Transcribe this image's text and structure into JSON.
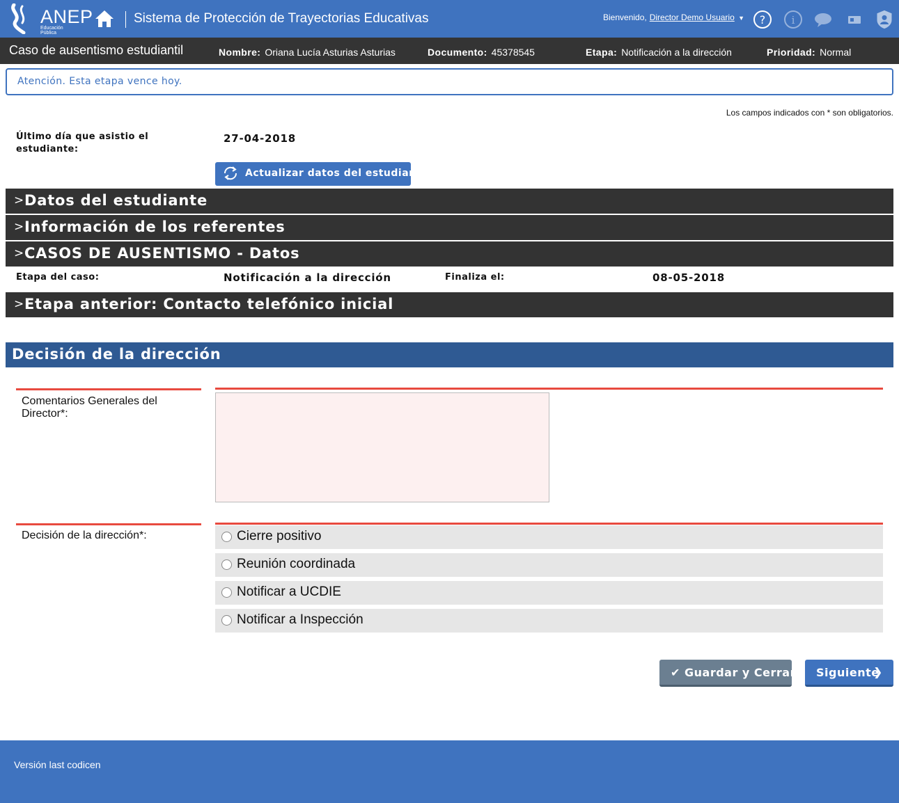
{
  "header": {
    "logo_text": "ANEP",
    "logo_sub": "Educación Pública",
    "app_title": "Sistema de Protección de Trayectorias Educativas",
    "welcome_label": "Bienvenido,",
    "user_name": "Director Demo Usuario",
    "icons": [
      "home-icon",
      "help-icon",
      "info-icon",
      "chat-icon",
      "id-card-icon",
      "profile-shield-icon"
    ]
  },
  "case": {
    "title": "Caso de ausentismo estudiantil",
    "name_label": "Nombre:",
    "name_value": "Oriana Lucía Asturias Asturias",
    "document_label": "Documento:",
    "document_value": "45378545",
    "stage_label": "Etapa:",
    "stage_value": "Notificación a la dirección",
    "priority_label": "Prioridad:",
    "priority_value": "Normal"
  },
  "alert": "Atención. Esta etapa vence hoy.",
  "required_note": "Los campos indicados con * son obligatorios.",
  "last_attendance": {
    "label": "Último día que asistio el estudiante:",
    "value": "27-04-2018"
  },
  "update_button": "Actualizar datos del estudiante",
  "sections": {
    "student": "Datos del estudiante",
    "referents": "Información de los referentes",
    "absence_cases": "CASOS DE AUSENTISMO - Datos",
    "previous_stage": "Etapa anterior: Contacto telefónico inicial"
  },
  "case_details": {
    "stage_label": "Etapa del caso:",
    "stage_value": "Notificación a la dirección",
    "ends_label": "Finaliza el:",
    "ends_value": "08-05-2018"
  },
  "decision_section": {
    "title": "Decisión de la dirección",
    "comments_label": "Comentarios Generales del Director*:",
    "comments_value": "",
    "decision_label": "Decisión de la dirección*:",
    "options": [
      "Cierre positivo",
      "Reunión coordinada",
      "Notificar a UCDIE",
      "Notificar a Inspección"
    ]
  },
  "buttons": {
    "save_close": "Guardar y Cerrar",
    "next": "Siguiente"
  },
  "footer": "Versión last codicen",
  "colors": {
    "brand_blue": "#3f73bf",
    "dark_bar": "#343434",
    "section_blue": "#2f5a93",
    "required_red": "#e84a3f"
  }
}
